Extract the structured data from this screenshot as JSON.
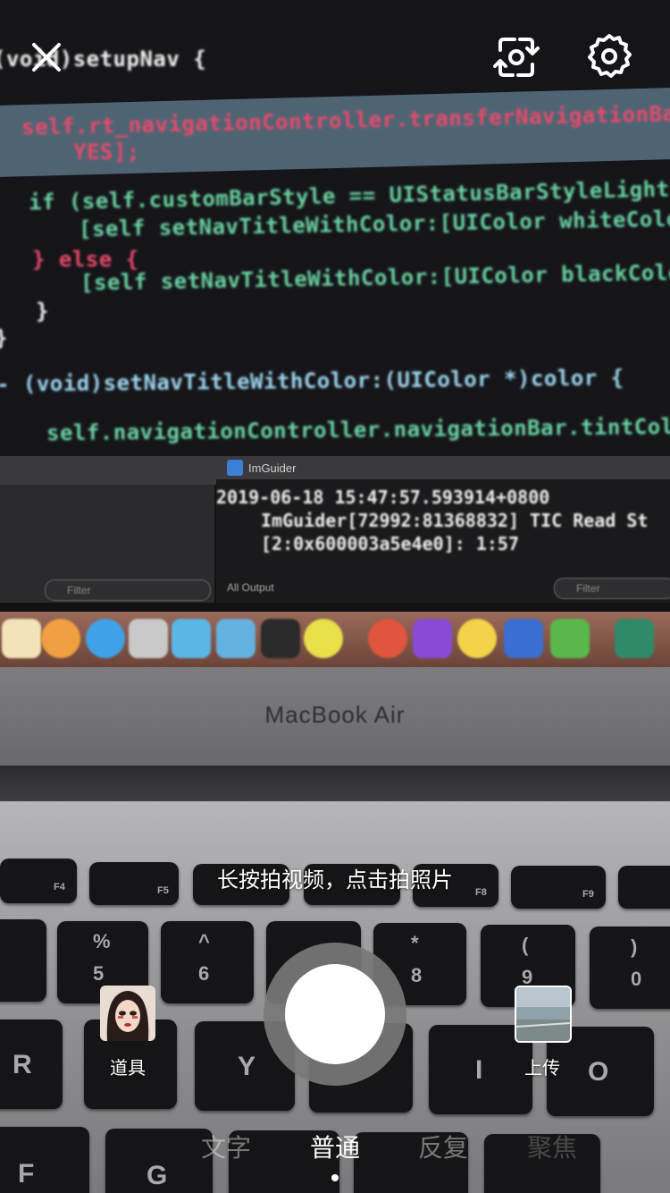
{
  "scene": {
    "code_lines": [
      "(void)setupNav {",
      "self.rt_navigationController.transferNavigationBarAttr",
      "YES];",
      "if (self.customBarStyle == UIStatusBarStyleLightConten",
      "[self setNavTitleWithColor:[UIColor whiteColor]];",
      "} else {",
      "[self setNavTitleWithColor:[UIColor blackColor]];",
      "}",
      "}",
      "- (void)setNavTitleWithColor:(UIColor *)color {",
      "self.navigationController.navigationBar.tintColor = col"
    ],
    "debug_target": "ImGuider",
    "console_lines": [
      "2019-06-18 15:47:57.593914+0800",
      "ImGuider[72992:81368832] TIC Read St",
      "[2:0x600003a5e4e0]: 1:57"
    ],
    "filter_label": "Filter",
    "output_label": "All Output",
    "laptop_brand": "MacBook Air",
    "keys": {
      "f4": "F4",
      "f5": "F5",
      "f8": "F8",
      "f9": "F9",
      "k5_top": "%",
      "k5": "5",
      "k6_top": "^",
      "k6": "6",
      "k8_top": "*",
      "k8": "8",
      "k9_top": "(",
      "k9": "9",
      "k0_top": ")",
      "k0": "0",
      "r": "R",
      "y": "Y",
      "i": "I",
      "o": "O",
      "f": "F",
      "g": "G"
    }
  },
  "camera": {
    "close_icon": "close-icon",
    "flip_icon": "flip-camera-icon",
    "settings_icon": "gear-icon",
    "hint": "长按拍视频，点击拍照片",
    "props_label": "道具",
    "upload_label": "上传",
    "modes": [
      "文字",
      "普通",
      "反复",
      "聚焦"
    ],
    "active_mode": "普通",
    "colors": {
      "overlay_text": "#ffffff",
      "shutter_ring": "#787878"
    }
  }
}
